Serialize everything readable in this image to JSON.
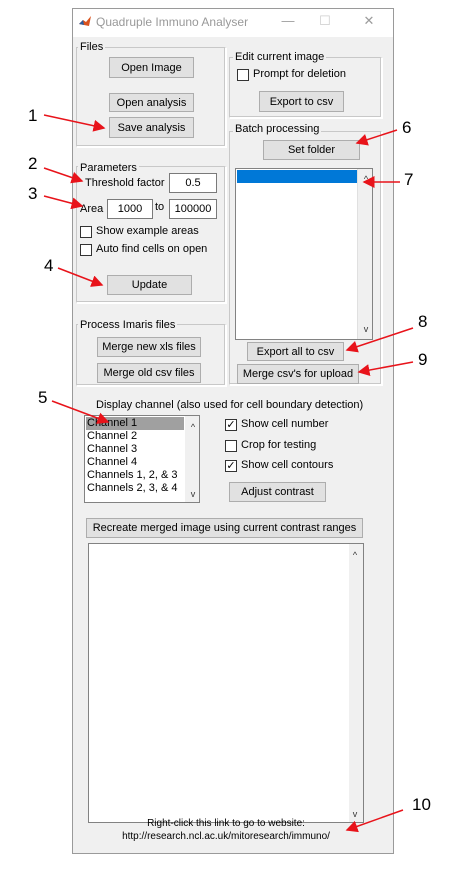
{
  "window": {
    "title": "Quadruple Immuno Analyser",
    "minimize_glyph": "—",
    "maximize_glyph": "☐",
    "close_glyph": "✕"
  },
  "files": {
    "label": "Files",
    "open_image": "Open Image",
    "open_analysis": "Open analysis",
    "save_analysis": "Save analysis"
  },
  "edit": {
    "label": "Edit current image",
    "prompt_for_deletion": "Prompt for deletion",
    "prompt_checked": false,
    "export_to_csv": "Export to csv"
  },
  "parameters": {
    "label": "Parameters",
    "threshold_label": "Threshold factor",
    "threshold_value": "0.5",
    "area_label": "Area",
    "area_min": "1000",
    "to_label": "to",
    "area_max": "100000",
    "show_example_areas": "Show example areas",
    "auto_find_cells": "Auto find cells on open",
    "update": "Update"
  },
  "batch": {
    "label": "Batch processing",
    "set_folder": "Set folder",
    "export_all": "Export all to csv",
    "merge_csvs": "Merge csv's for upload"
  },
  "imaris": {
    "label": "Process Imaris files",
    "merge_new": "Merge new xls files",
    "merge_old": "Merge old csv files"
  },
  "display": {
    "label": "Display channel (also used for cell boundary detection)",
    "channels": [
      "Channel 1",
      "Channel 2",
      "Channel 3",
      "Channel 4",
      "Channels 1, 2, & 3",
      "Channels 2, 3, & 4"
    ],
    "selected_index": 0,
    "show_cell_number": "Show cell number",
    "show_cell_number_checked": true,
    "crop_for_testing": "Crop for testing",
    "crop_checked": false,
    "show_cell_contours": "Show cell contours",
    "show_cell_contours_checked": true,
    "adjust_contrast": "Adjust contrast",
    "recreate": "Recreate merged image using current contrast ranges"
  },
  "footer": {
    "line1": "Right-click this link to go to website:",
    "line2": "http://research.ncl.ac.uk/mitoresearch/immuno/"
  },
  "annotations": [
    "1",
    "2",
    "3",
    "4",
    "5",
    "6",
    "7",
    "8",
    "9",
    "10"
  ],
  "colors": {
    "annotation_red": "#e8131a",
    "selection_blue": "#0078d7",
    "selected_item_grey": "#a0a0a0"
  }
}
